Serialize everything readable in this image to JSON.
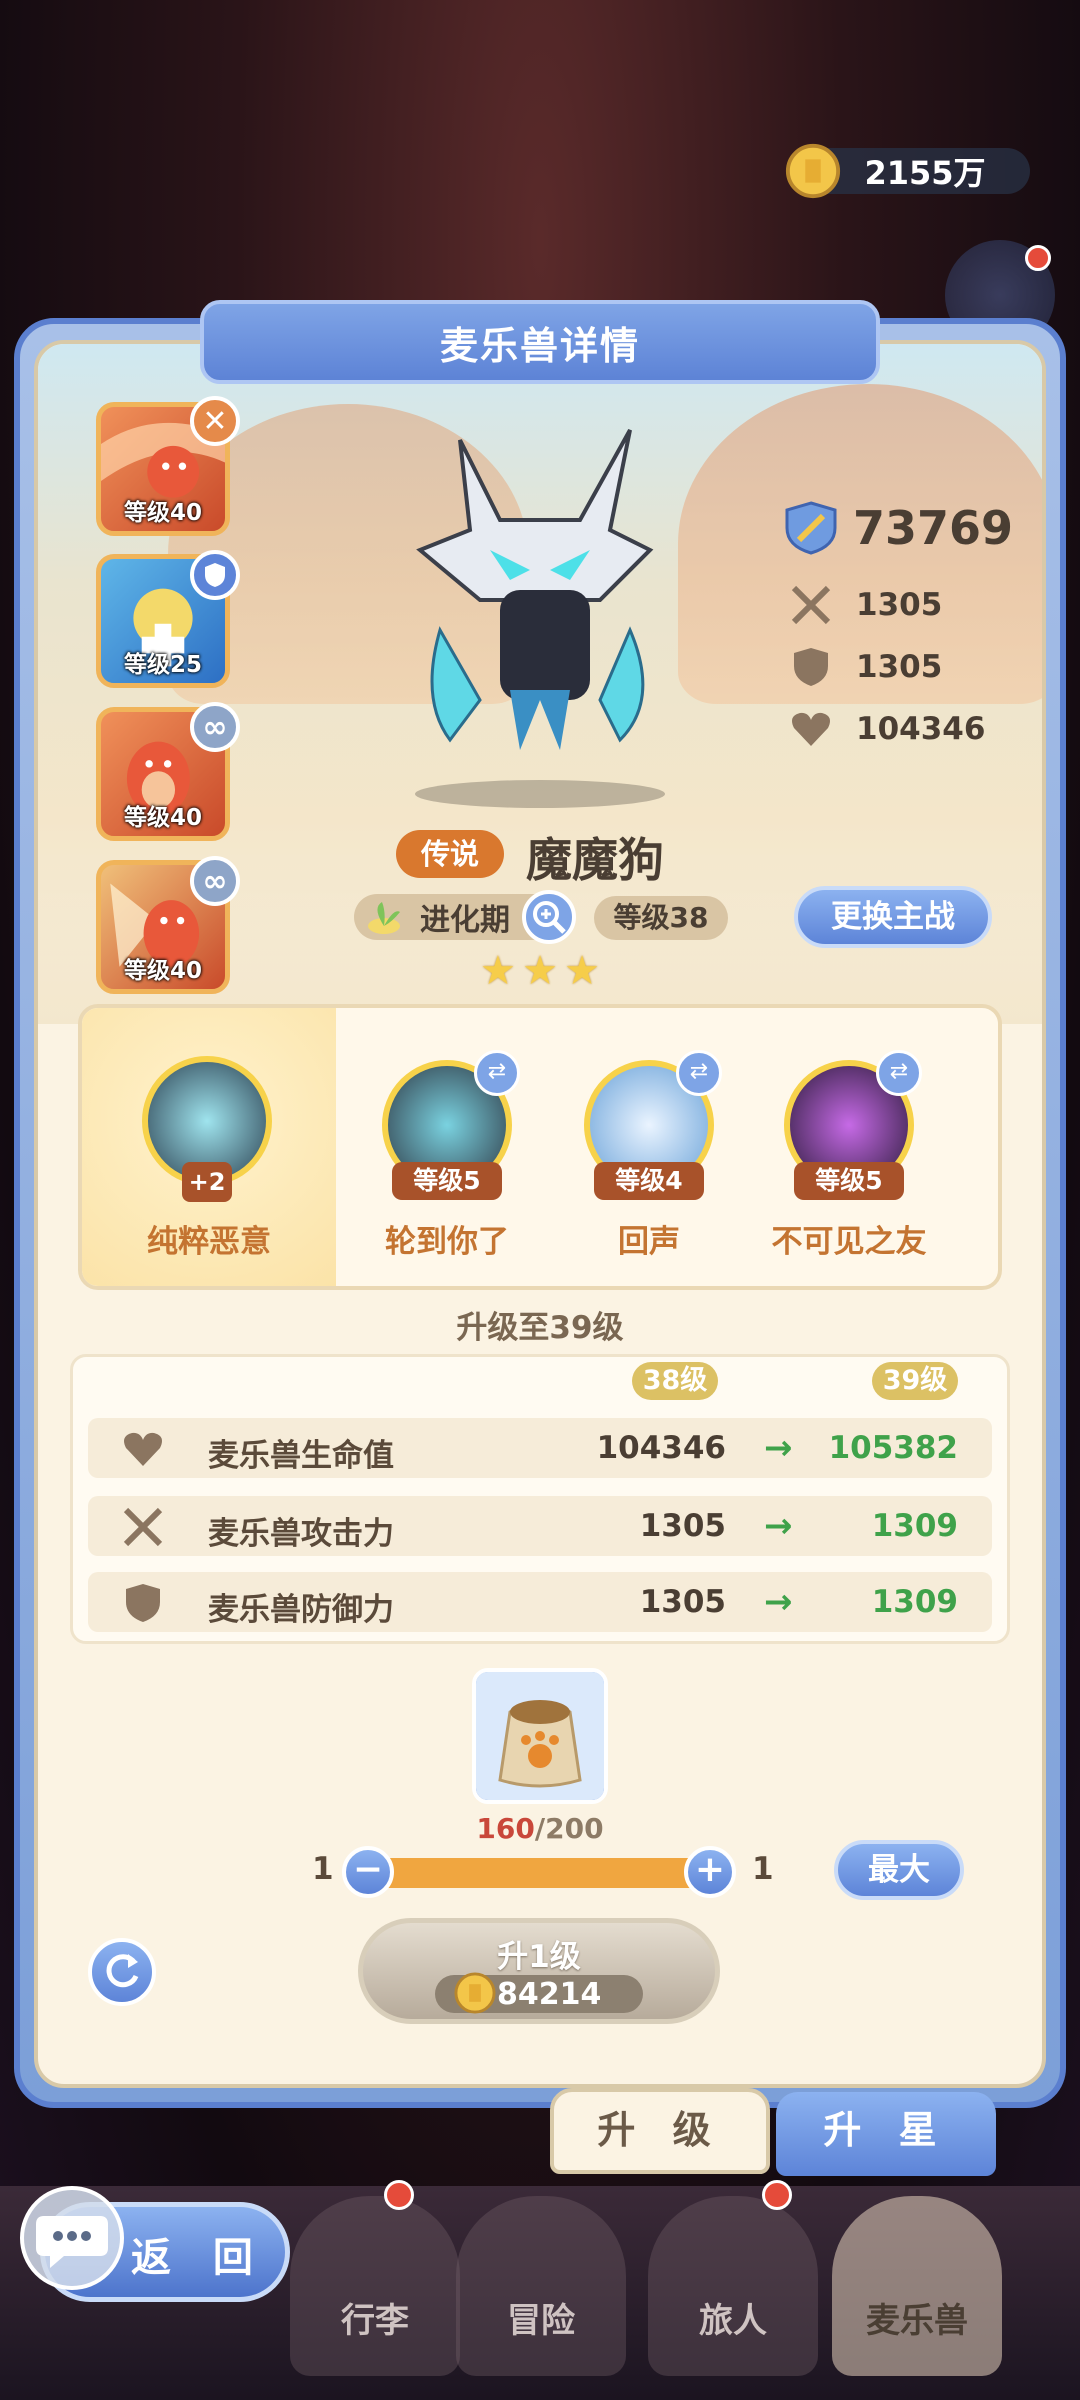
{
  "currency": {
    "amount": "2155万"
  },
  "panel": {
    "title": "麦乐兽详情"
  },
  "team": [
    {
      "level": "等级40",
      "badge": "✕",
      "badge_color": "#e58a4a"
    },
    {
      "level": "等级25",
      "badge": "shield",
      "badge_color": "#5d84d8"
    },
    {
      "level": "等级40",
      "badge": "link",
      "badge_color": "#8ea5c8"
    },
    {
      "level": "等级40",
      "badge": "link",
      "badge_color": "#8ea5c8"
    }
  ],
  "stats": {
    "power": "73769",
    "attack": "1305",
    "defense": "1305",
    "hp": "104346"
  },
  "monster": {
    "rarity": "传说",
    "name": "魔魔狗",
    "stage": "进化期",
    "level": "等级38",
    "stars": 3
  },
  "change_button": "更换主战",
  "skills": [
    {
      "name": "纯粹恶意",
      "badge": "+2"
    },
    {
      "name": "轮到你了",
      "level": "等级5"
    },
    {
      "name": "回声",
      "level": "等级4"
    },
    {
      "name": "不可见之友",
      "level": "等级5"
    }
  ],
  "upgrade": {
    "title": "升级至39级",
    "from_level": "38级",
    "to_level": "39级",
    "rows": [
      {
        "label": "麦乐兽生命值",
        "current": "104346",
        "next": "105382",
        "icon": "heart-icon"
      },
      {
        "label": "麦乐兽攻击力",
        "current": "1305",
        "next": "1309",
        "icon": "swords-icon"
      },
      {
        "label": "麦乐兽防御力",
        "current": "1305",
        "next": "1309",
        "icon": "shield-icon"
      }
    ]
  },
  "item": {
    "have": "160",
    "need": "/200"
  },
  "slider": {
    "min": "1",
    "max": "1",
    "max_button": "最大"
  },
  "level_up": {
    "label": "升1级",
    "cost": "84214"
  },
  "tabs": {
    "upgrade": "升 级",
    "star": "升 星"
  },
  "nav": {
    "back": "返 回",
    "items": [
      "行李",
      "冒险",
      "旅人",
      "麦乐兽"
    ]
  },
  "colors": {
    "accent": "#5d84d8",
    "gold": "#f0b45a",
    "green": "#3fa24a"
  }
}
